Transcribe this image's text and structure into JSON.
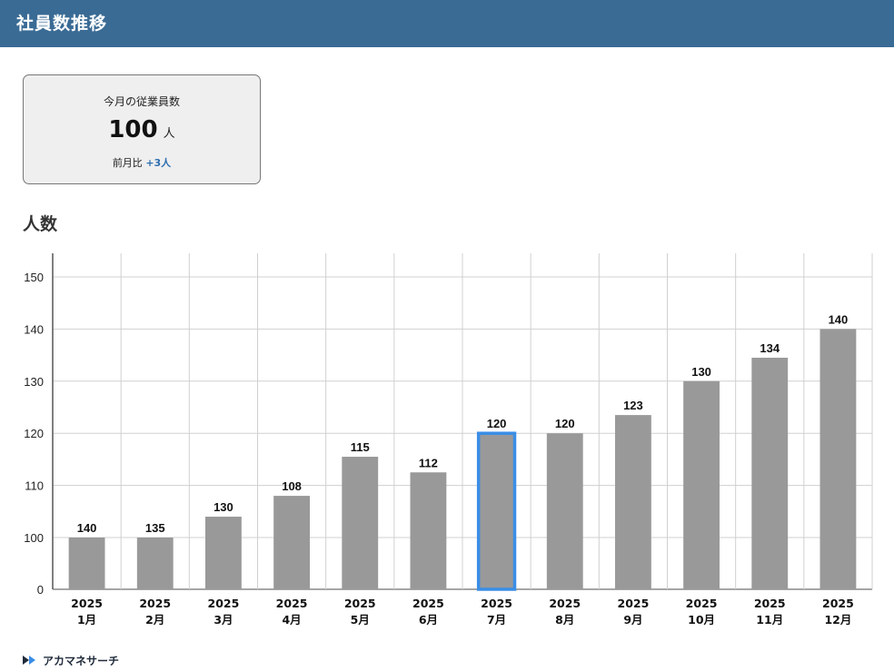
{
  "header": {
    "title": "社員数推移"
  },
  "stat_card": {
    "label": "今月の従業員数",
    "value": "100",
    "unit": "人",
    "compare_label": "前月比",
    "compare_delta": "+3人"
  },
  "section": {
    "title": "人数"
  },
  "footer": {
    "brand": "アカマネサーチ"
  },
  "colors": {
    "header": "#3a6b95",
    "bar": "#999999",
    "highlight": "#3a8ee6",
    "delta": "#2f6fb0"
  },
  "chart_data": {
    "type": "bar",
    "title": "人数",
    "xlabel": "",
    "ylabel": "",
    "categories": [
      [
        "2025",
        "1月"
      ],
      [
        "2025",
        "2月"
      ],
      [
        "2025",
        "3月"
      ],
      [
        "2025",
        "4月"
      ],
      [
        "2025",
        "5月"
      ],
      [
        "2025",
        "6月"
      ],
      [
        "2025",
        "7月"
      ],
      [
        "2025",
        "8月"
      ],
      [
        "2025",
        "9月"
      ],
      [
        "2025",
        "10月"
      ],
      [
        "2025",
        "11月"
      ],
      [
        "2025",
        "12月"
      ]
    ],
    "values": [
      100,
      100,
      104,
      108,
      115.5,
      112.5,
      120,
      120,
      123.5,
      130,
      134.5,
      140
    ],
    "data_labels": [
      "140",
      "135",
      "130",
      "108",
      "115",
      "112",
      "120",
      "120",
      "123",
      "130",
      "134",
      "140"
    ],
    "yticks": [
      "0",
      "100",
      "110",
      "120",
      "130",
      "140",
      "150"
    ],
    "ylim": [
      100,
      150
    ],
    "highlight_index": 6,
    "grid": true,
    "legend": "none"
  }
}
